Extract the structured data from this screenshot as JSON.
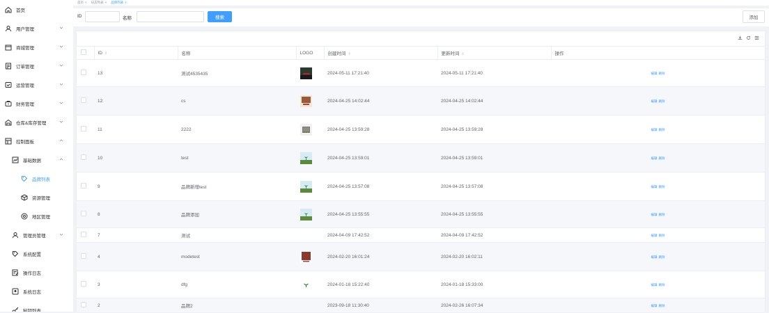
{
  "sidebar": {
    "items": [
      {
        "label": "首页",
        "icon": "home-icon",
        "level": 0,
        "chevron": ""
      },
      {
        "label": "用户管理",
        "icon": "user-icon",
        "level": 0,
        "chevron": "down"
      },
      {
        "label": "商城管理",
        "icon": "store-icon",
        "level": 0,
        "chevron": "down"
      },
      {
        "label": "订单管理",
        "icon": "order-icon",
        "level": 0,
        "chevron": "down"
      },
      {
        "label": "运营管理",
        "icon": "operation-icon",
        "level": 0,
        "chevron": "down"
      },
      {
        "label": "财务管理",
        "icon": "finance-icon",
        "level": 0,
        "chevron": "down"
      },
      {
        "label": "仓库&库存管理",
        "icon": "warehouse-icon",
        "level": 0,
        "chevron": "down"
      },
      {
        "label": "控制面板",
        "icon": "dashboard-icon",
        "level": 0,
        "chevron": "up"
      },
      {
        "label": "基础数据",
        "icon": "chart-icon",
        "level": 1,
        "chevron": "up"
      },
      {
        "label": "品牌列表",
        "icon": "tag-icon",
        "level": 2,
        "chevron": "",
        "active": true
      },
      {
        "label": "资源管理",
        "icon": "cube-icon",
        "level": 2,
        "chevron": ""
      },
      {
        "label": "地区管理",
        "icon": "location-icon",
        "level": 2,
        "chevron": ""
      },
      {
        "label": "管理员管理",
        "icon": "admin-icon",
        "level": 1,
        "chevron": "down"
      },
      {
        "label": "系统配置",
        "icon": "tag-icon",
        "level": 1,
        "chevron": ""
      },
      {
        "label": "操作日志",
        "icon": "edit-log-icon",
        "level": 1,
        "chevron": ""
      },
      {
        "label": "系统日志",
        "icon": "monitor-icon",
        "level": 1,
        "chevron": ""
      },
      {
        "label": "秘钥列表",
        "icon": "key-icon",
        "level": 1,
        "chevron": ""
      }
    ]
  },
  "tabs": [
    {
      "label": "首页",
      "close": "×",
      "active": false
    },
    {
      "label": "日志列表",
      "close": "×",
      "active": false
    },
    {
      "label": "品牌列表",
      "close": "×",
      "active": true
    }
  ],
  "search": {
    "id_label": "ID",
    "id_value": "",
    "name_label": "名称",
    "name_value": "",
    "search_button": "搜索",
    "add_button": "添加"
  },
  "table": {
    "headers": {
      "id": "ID",
      "name": "名称",
      "logo": "LOGO",
      "created": "创建时间",
      "updated": "更新时间",
      "ops": "操作"
    },
    "sort_glyph": "⇕",
    "edit_label": "编辑",
    "delete_label": "删除",
    "rows": [
      {
        "id": "13",
        "name": "测试4535435",
        "logo": "car",
        "created": "2024-05-11 17:21:40",
        "updated": "2024-05-11 17:21:40"
      },
      {
        "id": "12",
        "name": "cs",
        "logo": "poster",
        "created": "2024-04-25 14:02:44",
        "updated": "2024-04-25 14:02:44"
      },
      {
        "id": "11",
        "name": "2222",
        "logo": "building",
        "created": "2024-04-25 13:59:28",
        "updated": "2024-04-25 13:59:28"
      },
      {
        "id": "10",
        "name": "test",
        "logo": "sprout",
        "created": "2024-04-25 13:59:01",
        "updated": "2024-04-25 13:59:01"
      },
      {
        "id": "9",
        "name": "品牌新增test",
        "logo": "sprout",
        "created": "2024-04-25 13:57:08",
        "updated": "2024-04-25 13:57:08"
      },
      {
        "id": "8",
        "name": "品牌添加",
        "logo": "sprout",
        "created": "2024-04-25 13:55:55",
        "updated": "2024-04-25 13:55:55"
      },
      {
        "id": "7",
        "name": "测试",
        "logo": "",
        "created": "2024-04-09 17:42:52",
        "updated": "2024-04-09 17:42:52"
      },
      {
        "id": "4",
        "name": "modetest",
        "logo": "poster2",
        "created": "2024-02-20 16:01:24",
        "updated": "2024-02-20 16:02:11"
      },
      {
        "id": "3",
        "name": "dfg",
        "logo": "plant",
        "created": "2024-01-18 15:22:40",
        "updated": "2024-01-18 15:33:00"
      },
      {
        "id": "2",
        "name": "品牌2",
        "logo": "",
        "created": "2023-09-18 11:30:40",
        "updated": "2024-02-26 16:07:34"
      }
    ]
  }
}
